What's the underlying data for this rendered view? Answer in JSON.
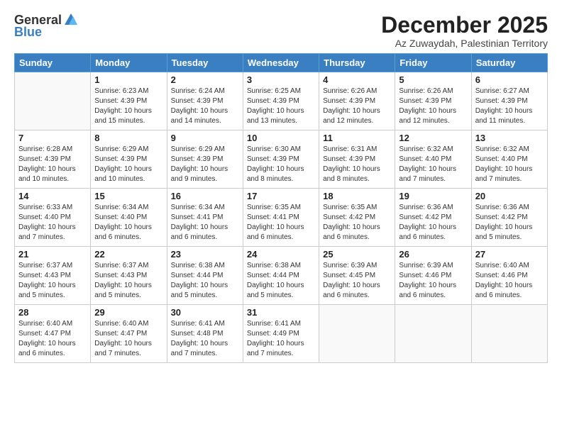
{
  "logo": {
    "general": "General",
    "blue": "Blue"
  },
  "title": "December 2025",
  "subtitle": "Az Zuwaydah, Palestinian Territory",
  "days_header": [
    "Sunday",
    "Monday",
    "Tuesday",
    "Wednesday",
    "Thursday",
    "Friday",
    "Saturday"
  ],
  "weeks": [
    [
      {
        "day": "",
        "info": ""
      },
      {
        "day": "1",
        "info": "Sunrise: 6:23 AM\nSunset: 4:39 PM\nDaylight: 10 hours\nand 15 minutes."
      },
      {
        "day": "2",
        "info": "Sunrise: 6:24 AM\nSunset: 4:39 PM\nDaylight: 10 hours\nand 14 minutes."
      },
      {
        "day": "3",
        "info": "Sunrise: 6:25 AM\nSunset: 4:39 PM\nDaylight: 10 hours\nand 13 minutes."
      },
      {
        "day": "4",
        "info": "Sunrise: 6:26 AM\nSunset: 4:39 PM\nDaylight: 10 hours\nand 12 minutes."
      },
      {
        "day": "5",
        "info": "Sunrise: 6:26 AM\nSunset: 4:39 PM\nDaylight: 10 hours\nand 12 minutes."
      },
      {
        "day": "6",
        "info": "Sunrise: 6:27 AM\nSunset: 4:39 PM\nDaylight: 10 hours\nand 11 minutes."
      }
    ],
    [
      {
        "day": "7",
        "info": "Sunrise: 6:28 AM\nSunset: 4:39 PM\nDaylight: 10 hours\nand 10 minutes."
      },
      {
        "day": "8",
        "info": "Sunrise: 6:29 AM\nSunset: 4:39 PM\nDaylight: 10 hours\nand 10 minutes."
      },
      {
        "day": "9",
        "info": "Sunrise: 6:29 AM\nSunset: 4:39 PM\nDaylight: 10 hours\nand 9 minutes."
      },
      {
        "day": "10",
        "info": "Sunrise: 6:30 AM\nSunset: 4:39 PM\nDaylight: 10 hours\nand 8 minutes."
      },
      {
        "day": "11",
        "info": "Sunrise: 6:31 AM\nSunset: 4:39 PM\nDaylight: 10 hours\nand 8 minutes."
      },
      {
        "day": "12",
        "info": "Sunrise: 6:32 AM\nSunset: 4:40 PM\nDaylight: 10 hours\nand 7 minutes."
      },
      {
        "day": "13",
        "info": "Sunrise: 6:32 AM\nSunset: 4:40 PM\nDaylight: 10 hours\nand 7 minutes."
      }
    ],
    [
      {
        "day": "14",
        "info": "Sunrise: 6:33 AM\nSunset: 4:40 PM\nDaylight: 10 hours\nand 7 minutes."
      },
      {
        "day": "15",
        "info": "Sunrise: 6:34 AM\nSunset: 4:40 PM\nDaylight: 10 hours\nand 6 minutes."
      },
      {
        "day": "16",
        "info": "Sunrise: 6:34 AM\nSunset: 4:41 PM\nDaylight: 10 hours\nand 6 minutes."
      },
      {
        "day": "17",
        "info": "Sunrise: 6:35 AM\nSunset: 4:41 PM\nDaylight: 10 hours\nand 6 minutes."
      },
      {
        "day": "18",
        "info": "Sunrise: 6:35 AM\nSunset: 4:42 PM\nDaylight: 10 hours\nand 6 minutes."
      },
      {
        "day": "19",
        "info": "Sunrise: 6:36 AM\nSunset: 4:42 PM\nDaylight: 10 hours\nand 6 minutes."
      },
      {
        "day": "20",
        "info": "Sunrise: 6:36 AM\nSunset: 4:42 PM\nDaylight: 10 hours\nand 5 minutes."
      }
    ],
    [
      {
        "day": "21",
        "info": "Sunrise: 6:37 AM\nSunset: 4:43 PM\nDaylight: 10 hours\nand 5 minutes."
      },
      {
        "day": "22",
        "info": "Sunrise: 6:37 AM\nSunset: 4:43 PM\nDaylight: 10 hours\nand 5 minutes."
      },
      {
        "day": "23",
        "info": "Sunrise: 6:38 AM\nSunset: 4:44 PM\nDaylight: 10 hours\nand 5 minutes."
      },
      {
        "day": "24",
        "info": "Sunrise: 6:38 AM\nSunset: 4:44 PM\nDaylight: 10 hours\nand 5 minutes."
      },
      {
        "day": "25",
        "info": "Sunrise: 6:39 AM\nSunset: 4:45 PM\nDaylight: 10 hours\nand 6 minutes."
      },
      {
        "day": "26",
        "info": "Sunrise: 6:39 AM\nSunset: 4:46 PM\nDaylight: 10 hours\nand 6 minutes."
      },
      {
        "day": "27",
        "info": "Sunrise: 6:40 AM\nSunset: 4:46 PM\nDaylight: 10 hours\nand 6 minutes."
      }
    ],
    [
      {
        "day": "28",
        "info": "Sunrise: 6:40 AM\nSunset: 4:47 PM\nDaylight: 10 hours\nand 6 minutes."
      },
      {
        "day": "29",
        "info": "Sunrise: 6:40 AM\nSunset: 4:47 PM\nDaylight: 10 hours\nand 7 minutes."
      },
      {
        "day": "30",
        "info": "Sunrise: 6:41 AM\nSunset: 4:48 PM\nDaylight: 10 hours\nand 7 minutes."
      },
      {
        "day": "31",
        "info": "Sunrise: 6:41 AM\nSunset: 4:49 PM\nDaylight: 10 hours\nand 7 minutes."
      },
      {
        "day": "",
        "info": ""
      },
      {
        "day": "",
        "info": ""
      },
      {
        "day": "",
        "info": ""
      }
    ]
  ]
}
